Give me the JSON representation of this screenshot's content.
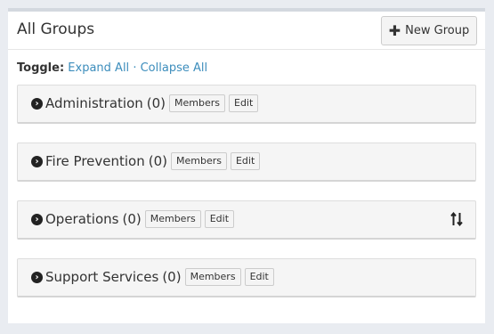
{
  "header": {
    "title": "All Groups",
    "new_group_label": "New Group",
    "new_group_icon": "plus-icon"
  },
  "toggle": {
    "label": "Toggle:",
    "expand_all": "Expand All",
    "separator": "·",
    "collapse_all": "Collapse All"
  },
  "groups": [
    {
      "name": "Administration",
      "count": "(0)",
      "members_label": "Members",
      "edit_label": "Edit"
    },
    {
      "name": "Fire Prevention",
      "count": "(0)",
      "members_label": "Members",
      "edit_label": "Edit"
    },
    {
      "name": "Operations",
      "count": "(0)",
      "members_label": "Members",
      "edit_label": "Edit"
    },
    {
      "name": "Support Services",
      "count": "(0)",
      "members_label": "Members",
      "edit_label": "Edit"
    }
  ],
  "colors": {
    "link": "#3c8dbc",
    "panel_border": "#d3d8df",
    "group_bg": "#f5f5f5"
  }
}
